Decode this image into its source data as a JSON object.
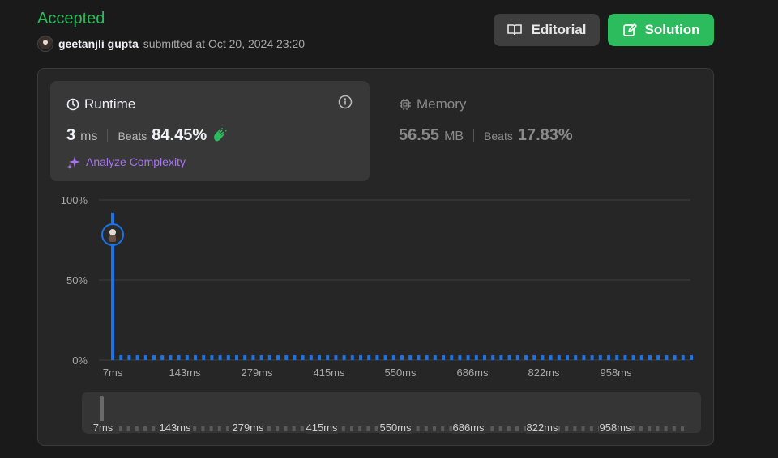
{
  "header": {
    "status": "Accepted",
    "username": "geetanjli gupta",
    "submitted_text": "submitted at Oct 20, 2024 23:20",
    "editorial_label": "Editorial",
    "solution_label": "Solution"
  },
  "runtime": {
    "title": "Runtime",
    "value": "3",
    "unit": "ms",
    "beats_label": "Beats",
    "beats_value": "84.45%",
    "analyze_label": "Analyze Complexity"
  },
  "memory": {
    "title": "Memory",
    "value": "56.55",
    "unit": "MB",
    "beats_label": "Beats",
    "beats_value": "17.83%"
  },
  "colors": {
    "accepted": "#2cbb5d",
    "bar": "#1a73e8",
    "analyze": "#a773f2"
  },
  "chart_data": {
    "type": "bar",
    "title": "",
    "xlabel": "",
    "ylabel": "",
    "y_ticks": [
      "100%",
      "50%",
      "0%"
    ],
    "x_ticks": [
      "7ms",
      "143ms",
      "279ms",
      "415ms",
      "550ms",
      "686ms",
      "822ms",
      "958ms"
    ],
    "ylim": [
      0,
      100
    ],
    "bins": 71,
    "highlight_bin": 0,
    "highlight_value": 92,
    "base_value": 3,
    "grid": true,
    "navigator_ticks": [
      "7ms",
      "143ms",
      "279ms",
      "415ms",
      "550ms",
      "686ms",
      "822ms",
      "958ms"
    ]
  }
}
